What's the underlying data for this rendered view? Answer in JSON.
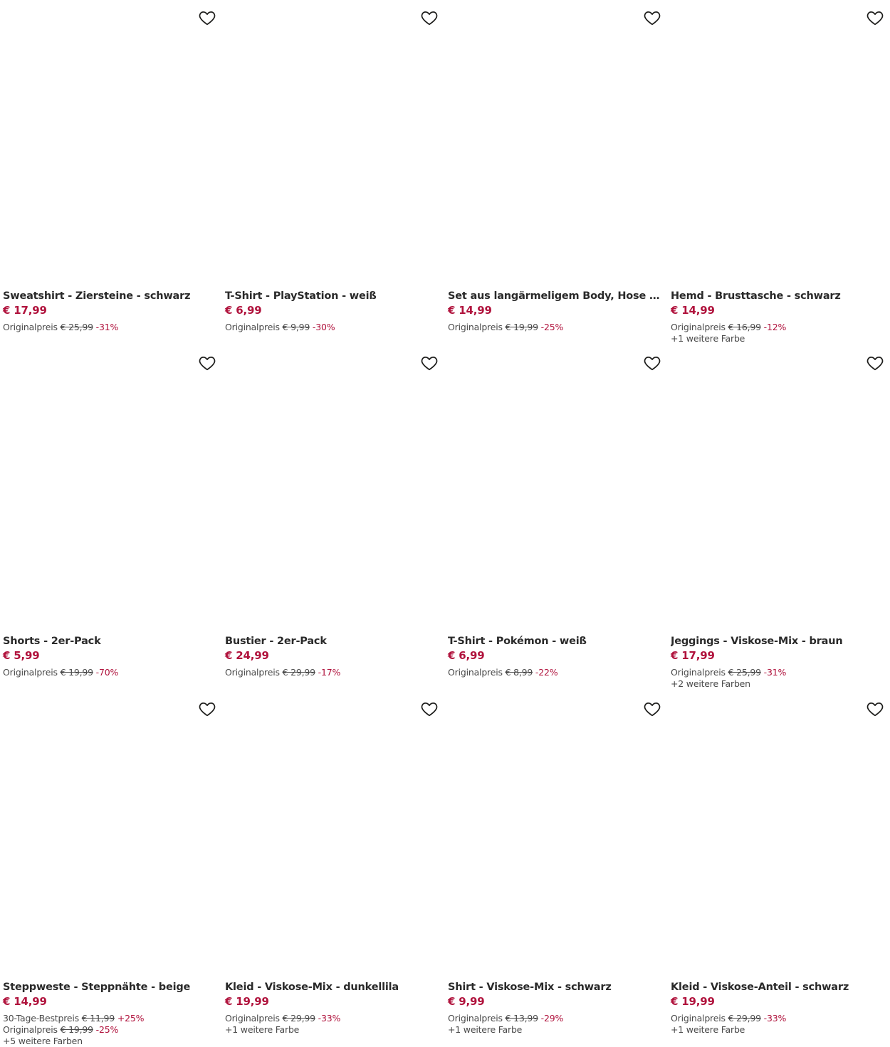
{
  "accent_color": "#b0123c",
  "icon": "heart-outline-icon",
  "products": [
    {
      "title": "Sweatshirt - Ziersteine - schwarz",
      "price": "€ 17,99",
      "lines": [
        {
          "label": "Originalpreis",
          "old": "€ 25,99",
          "disc": "-31%"
        }
      ],
      "colors": ""
    },
    {
      "title": "T-Shirt - PlayStation - weiß",
      "price": "€ 6,99",
      "lines": [
        {
          "label": "Originalpreis",
          "old": "€ 9,99",
          "disc": "-30%"
        }
      ],
      "colors": ""
    },
    {
      "title": "Set aus langärmeligem Body, Hose und Mütze",
      "price": "€ 14,99",
      "lines": [
        {
          "label": "Originalpreis",
          "old": "€ 19,99",
          "disc": "-25%"
        }
      ],
      "colors": ""
    },
    {
      "title": "Hemd - Brusttasche - schwarz",
      "price": "€ 14,99",
      "lines": [
        {
          "label": "Originalpreis",
          "old": "€ 16,99",
          "disc": "-12%"
        }
      ],
      "colors": "+1 weitere Farbe"
    },
    {
      "title": "Shorts - 2er-Pack",
      "price": "€ 5,99",
      "lines": [
        {
          "label": "Originalpreis",
          "old": "€ 19,99",
          "disc": "-70%"
        }
      ],
      "colors": ""
    },
    {
      "title": "Bustier - 2er-Pack",
      "price": "€ 24,99",
      "lines": [
        {
          "label": "Originalpreis",
          "old": "€ 29,99",
          "disc": "-17%"
        }
      ],
      "colors": ""
    },
    {
      "title": "T-Shirt - Pokémon - weiß",
      "price": "€ 6,99",
      "lines": [
        {
          "label": "Originalpreis",
          "old": "€ 8,99",
          "disc": "-22%"
        }
      ],
      "colors": ""
    },
    {
      "title": "Jeggings - Viskose-Mix - braun",
      "price": "€ 17,99",
      "lines": [
        {
          "label": "Originalpreis",
          "old": "€ 25,99",
          "disc": "-31%"
        }
      ],
      "colors": "+2 weitere Farben"
    },
    {
      "title": "Steppweste - Steppnähte - beige",
      "price": "€ 14,99",
      "lines": [
        {
          "label": "30-Tage-Bestpreis",
          "old": "€ 11,99",
          "disc": "+25%"
        },
        {
          "label": "Originalpreis",
          "old": "€ 19,99",
          "disc": "-25%"
        }
      ],
      "colors": "+5 weitere Farben"
    },
    {
      "title": "Kleid - Viskose-Mix - dunkellila",
      "price": "€ 19,99",
      "lines": [
        {
          "label": "Originalpreis",
          "old": "€ 29,99",
          "disc": "-33%"
        }
      ],
      "colors": "+1 weitere Farbe"
    },
    {
      "title": "Shirt - Viskose-Mix - schwarz",
      "price": "€ 9,99",
      "lines": [
        {
          "label": "Originalpreis",
          "old": "€ 13,99",
          "disc": "-29%"
        }
      ],
      "colors": "+1 weitere Farbe"
    },
    {
      "title": "Kleid - Viskose-Anteil - schwarz",
      "price": "€ 19,99",
      "lines": [
        {
          "label": "Originalpreis",
          "old": "€ 29,99",
          "disc": "-33%"
        }
      ],
      "colors": "+1 weitere Farbe"
    }
  ]
}
